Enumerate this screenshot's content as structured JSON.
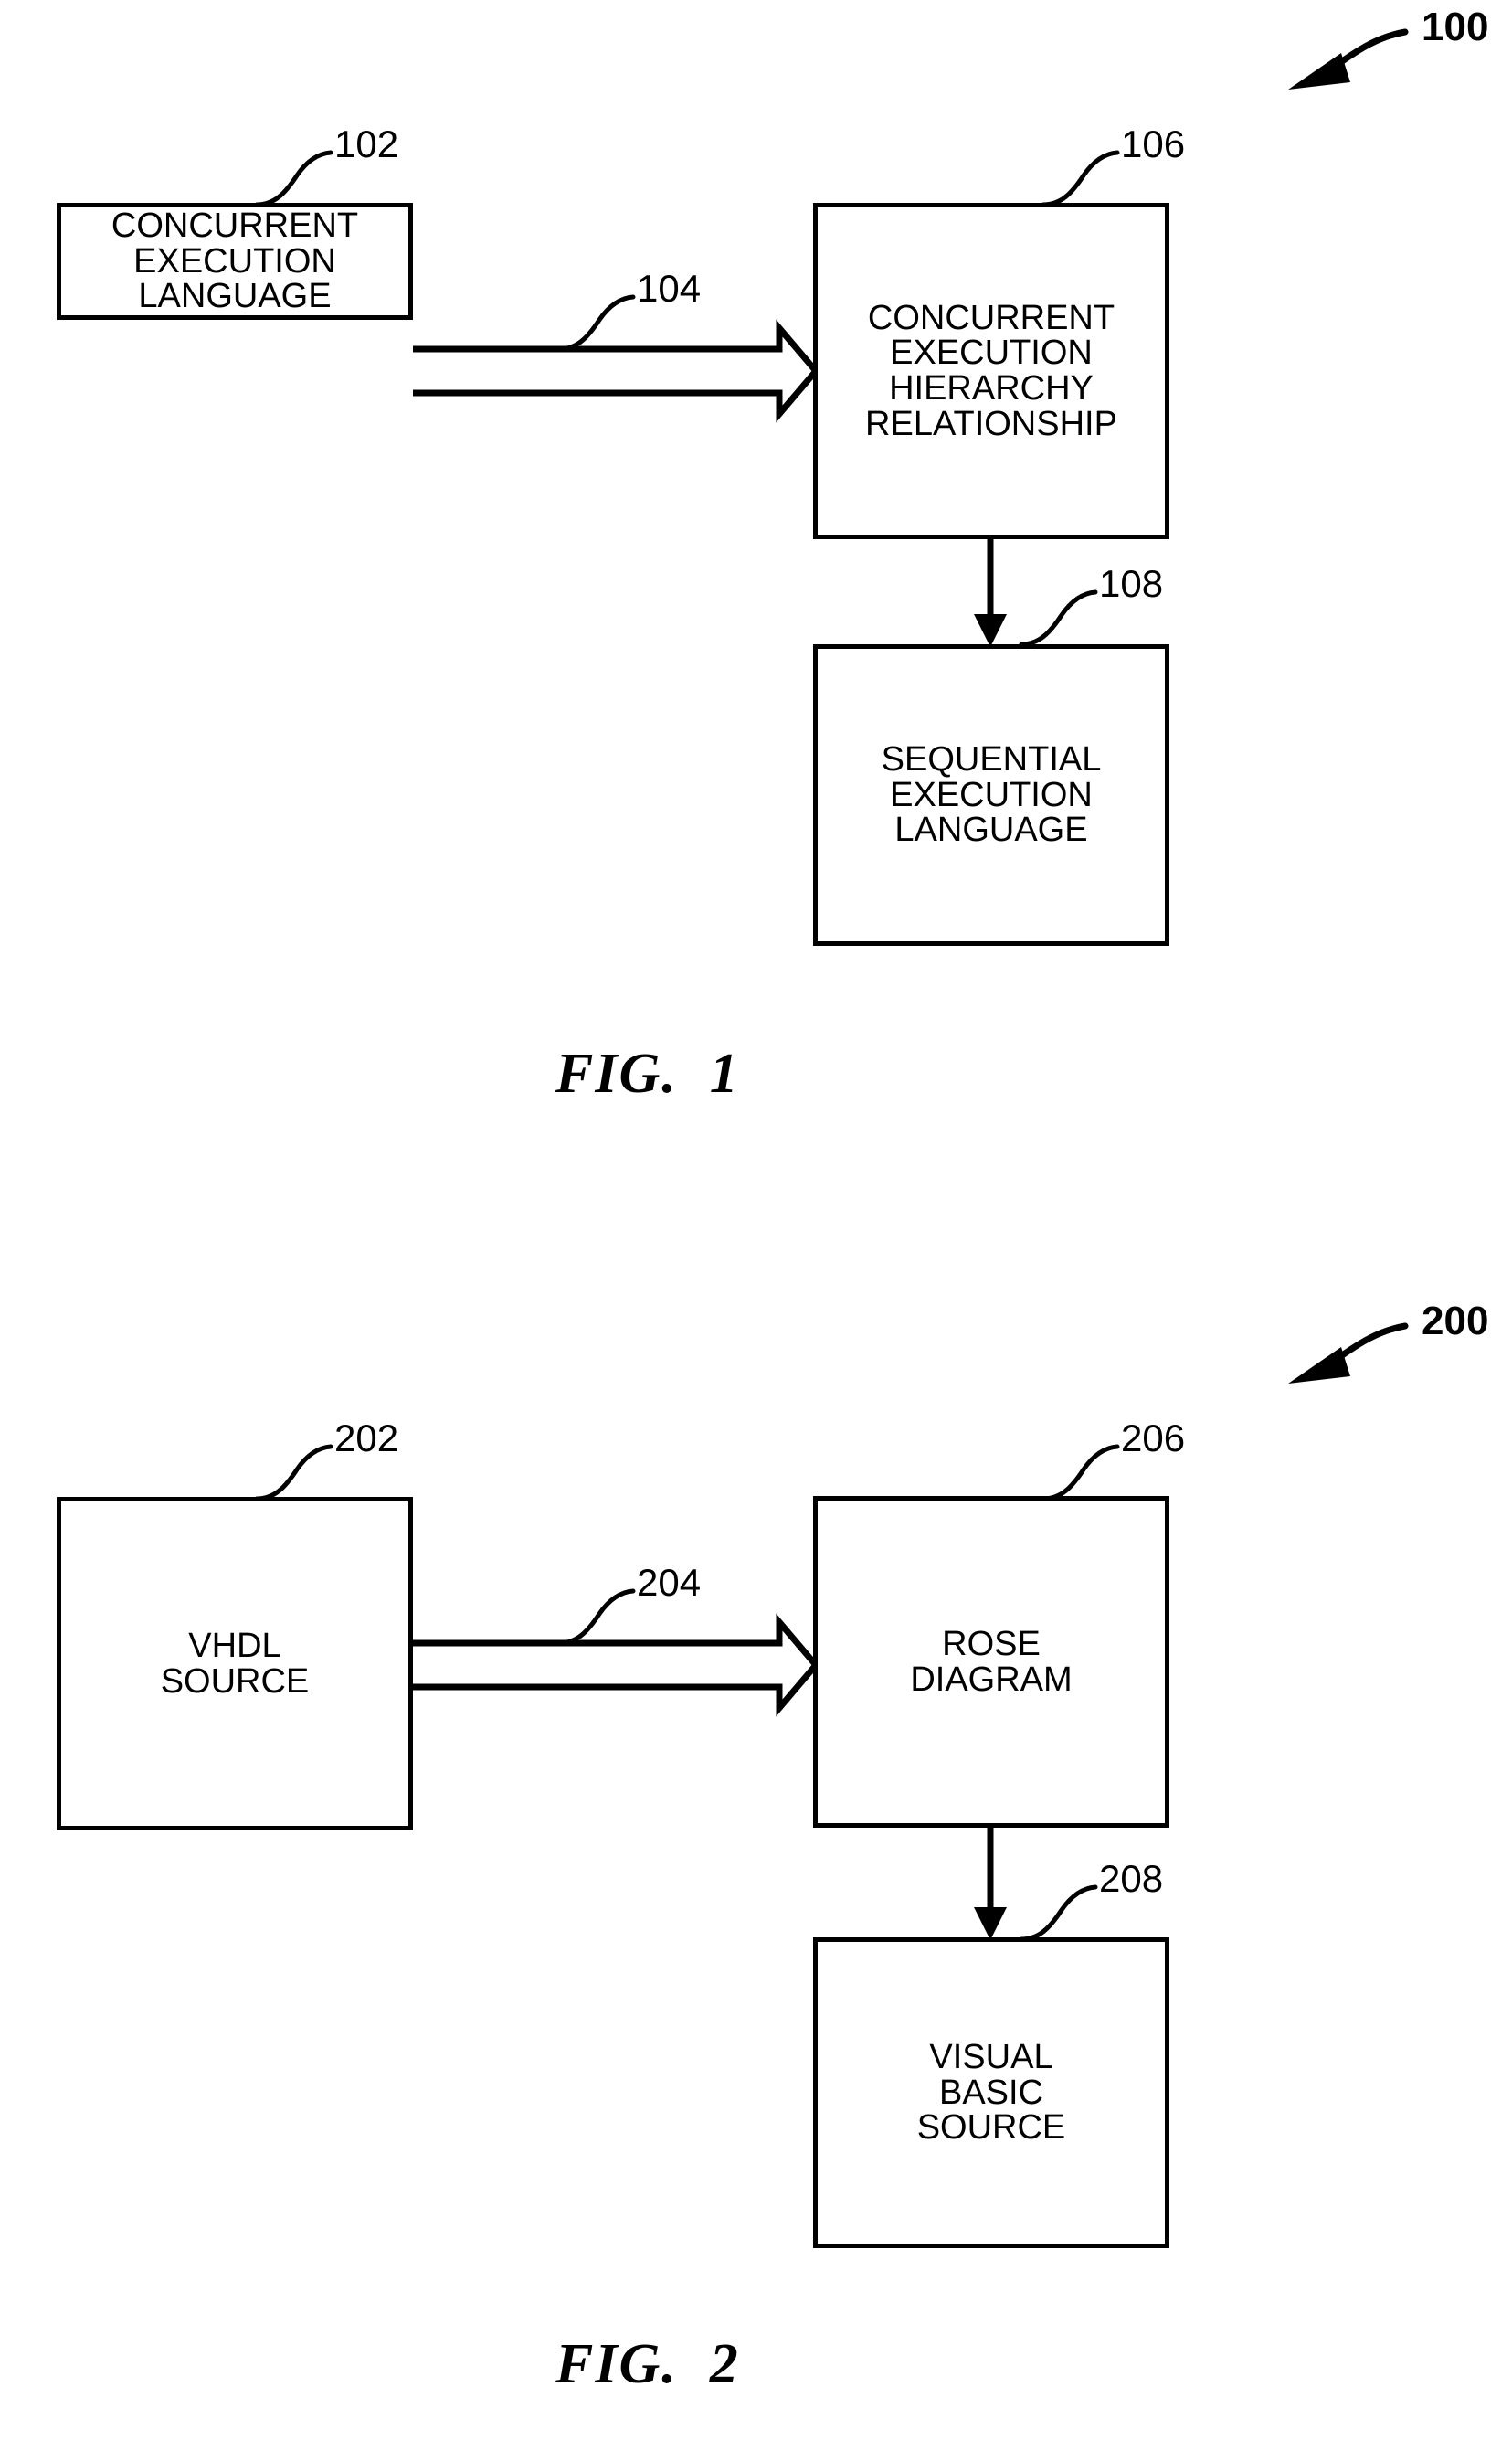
{
  "document": {
    "type": "patent-figure-sheet",
    "figures": [
      {
        "id": "fig1",
        "caption": "FIG.  1",
        "system_numeral": "100",
        "nodes": [
          {
            "ref": "102",
            "label": "CONCURRENT\nEXECUTION\nLANGUAGE"
          },
          {
            "ref": "106",
            "label": "CONCURRENT\nEXECUTION\nHIERARCHY\nRELATIONSHIP"
          },
          {
            "ref": "108",
            "label": "SEQUENTIAL\nEXECUTION\nLANGUAGE"
          }
        ],
        "connectors": [
          {
            "ref": "104",
            "from": "102",
            "to": "106",
            "style": "block-arrow"
          },
          {
            "ref": "",
            "from": "106",
            "to": "108",
            "style": "line-arrow"
          }
        ]
      },
      {
        "id": "fig2",
        "caption": "FIG.  2",
        "system_numeral": "200",
        "nodes": [
          {
            "ref": "202",
            "label": "VHDL\nSOURCE"
          },
          {
            "ref": "206",
            "label": "ROSE\nDIAGRAM"
          },
          {
            "ref": "208",
            "label": "VISUAL\nBASIC\nSOURCE"
          }
        ],
        "connectors": [
          {
            "ref": "204",
            "from": "202",
            "to": "206",
            "style": "block-arrow"
          },
          {
            "ref": "",
            "from": "206",
            "to": "208",
            "style": "line-arrow"
          }
        ]
      }
    ],
    "colors": {
      "ink": "#000000",
      "paper": "#ffffff"
    }
  }
}
